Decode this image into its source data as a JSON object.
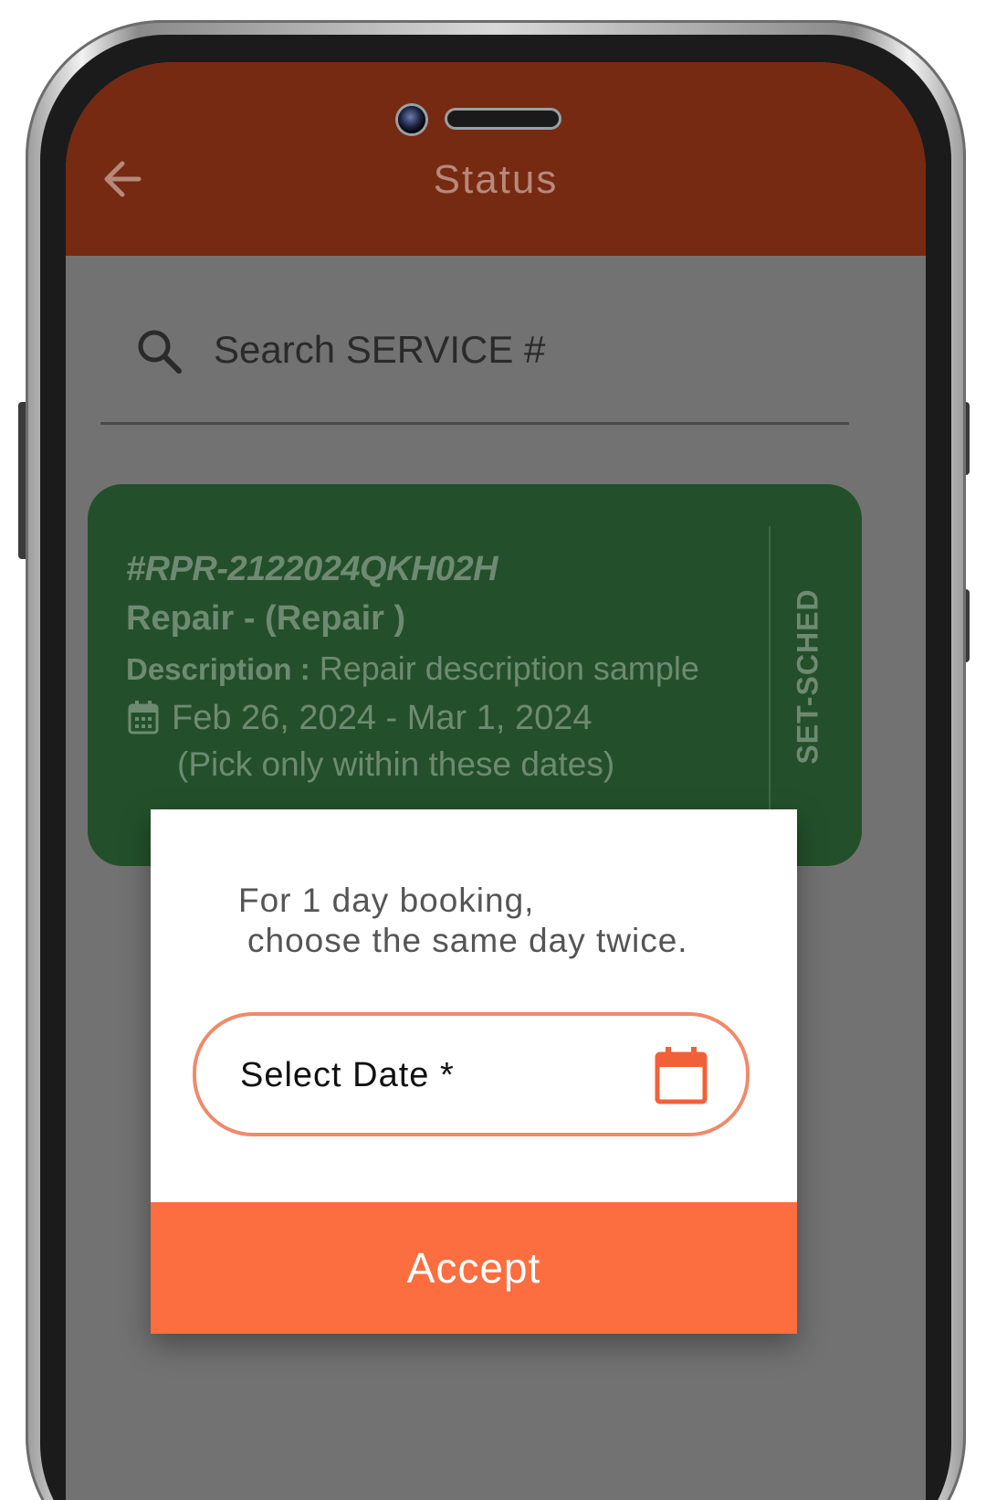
{
  "app_bar": {
    "title": "Status",
    "back_icon": "arrow-left-icon",
    "background": "#762a12"
  },
  "search": {
    "placeholder": "Search SERVICE #",
    "icon": "search-icon"
  },
  "service_card": {
    "id": "#RPR-2122024QKH02H",
    "type": "Repair - (Repair )",
    "description_label": "Description :",
    "description_value": "Repair description sample",
    "date_range": "Feb 26, 2024 - Mar 1, 2024",
    "date_note": "(Pick only within these dates)",
    "status": "SET-SCHED",
    "calendar_icon": "calendar-icon",
    "background": "#23502a"
  },
  "dialog": {
    "message_line1": "For 1 day booking,",
    "message_line2": "choose the same day twice.",
    "date_field_label": "Select Date *",
    "date_field_icon": "calendar-icon",
    "accept_label": "Accept",
    "accent": "#fc6e40",
    "field_border": "#f08a6a"
  }
}
